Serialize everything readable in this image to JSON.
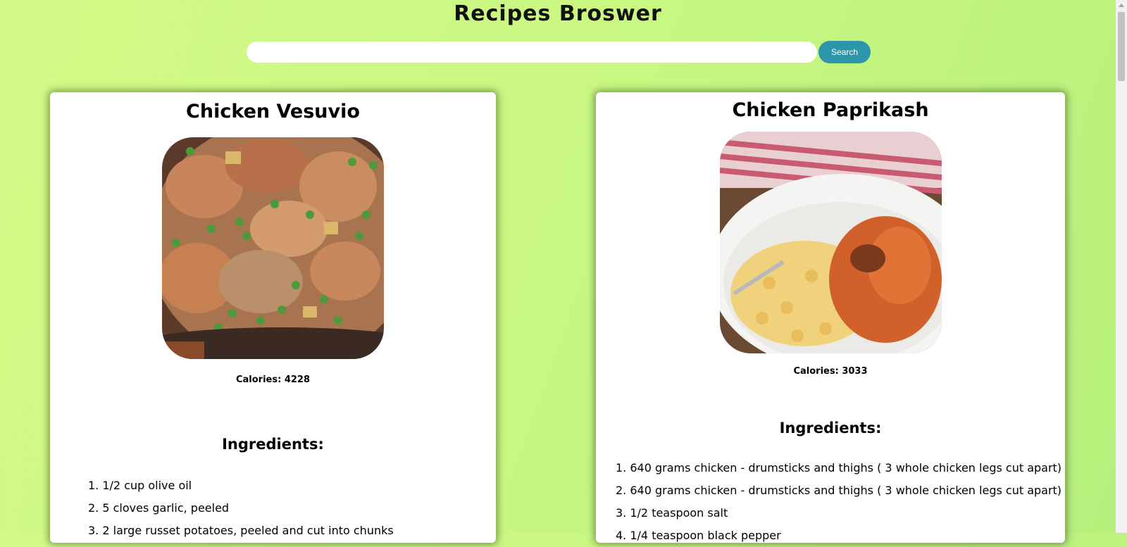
{
  "app": {
    "title": "Recipes Broswer"
  },
  "search": {
    "placeholder": "",
    "value": "",
    "button_label": "Search"
  },
  "recipes": [
    {
      "title": "Chicken Vesuvio",
      "calories": "Calories: 4228",
      "ingredients_heading": "Ingredients:",
      "ingredients": [
        "1. 1/2 cup olive oil",
        "2. 5 cloves garlic, peeled",
        "3. 2 large russet potatoes, peeled and cut into chunks"
      ]
    },
    {
      "title": "Chicken Paprikash",
      "calories": "Calories: 3033",
      "ingredients_heading": "Ingredients:",
      "ingredients": [
        "1. 640 grams chicken - drumsticks and thighs ( 3 whole chicken legs cut apart)",
        "2. 640 grams chicken - drumsticks and thighs ( 3 whole chicken legs cut apart)",
        "3. 1/2 teaspoon salt",
        "4. 1/4 teaspoon black pepper"
      ]
    }
  ],
  "colors": {
    "accent": "#2b95aa",
    "background": "#c8f782",
    "card": "#ffffff"
  }
}
